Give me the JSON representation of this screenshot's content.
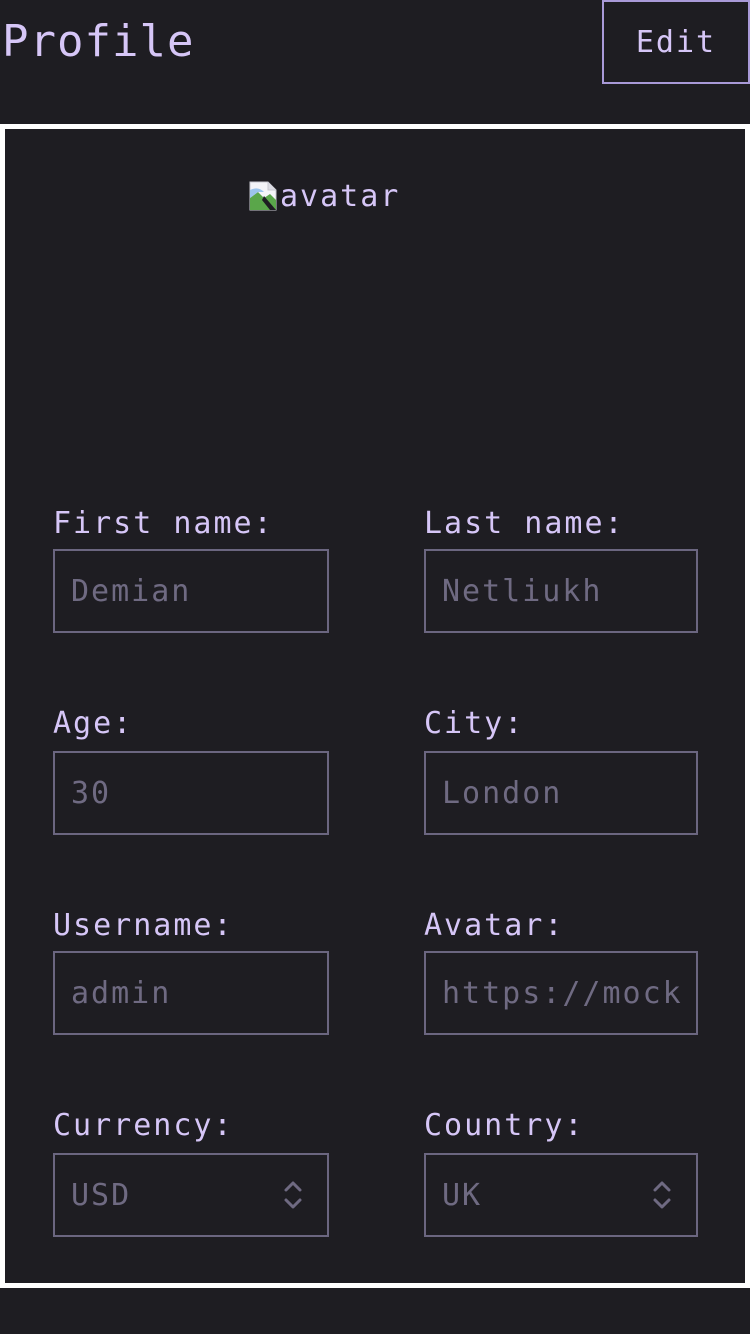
{
  "header": {
    "title": "Profile",
    "edit_label": "Edit"
  },
  "avatar": {
    "alt": "avatar",
    "icon": "broken-image-icon"
  },
  "fields": {
    "first_name": {
      "label": "First name:",
      "placeholder": "Demian"
    },
    "last_name": {
      "label": "Last name:",
      "placeholder": "Netliukh"
    },
    "age": {
      "label": "Age:",
      "placeholder": "30"
    },
    "city": {
      "label": "City:",
      "placeholder": "London"
    },
    "username": {
      "label": "Username:",
      "placeholder": "admin"
    },
    "avatar_url": {
      "label": "Avatar:",
      "placeholder": "https://mock"
    },
    "currency": {
      "label": "Currency:",
      "value": "USD"
    },
    "country": {
      "label": "Country:",
      "value": "UK"
    }
  },
  "colors": {
    "background": "#1e1d22",
    "accent": "#d6c6f7",
    "border": "#6b6680",
    "panel_border": "#ffffff"
  }
}
